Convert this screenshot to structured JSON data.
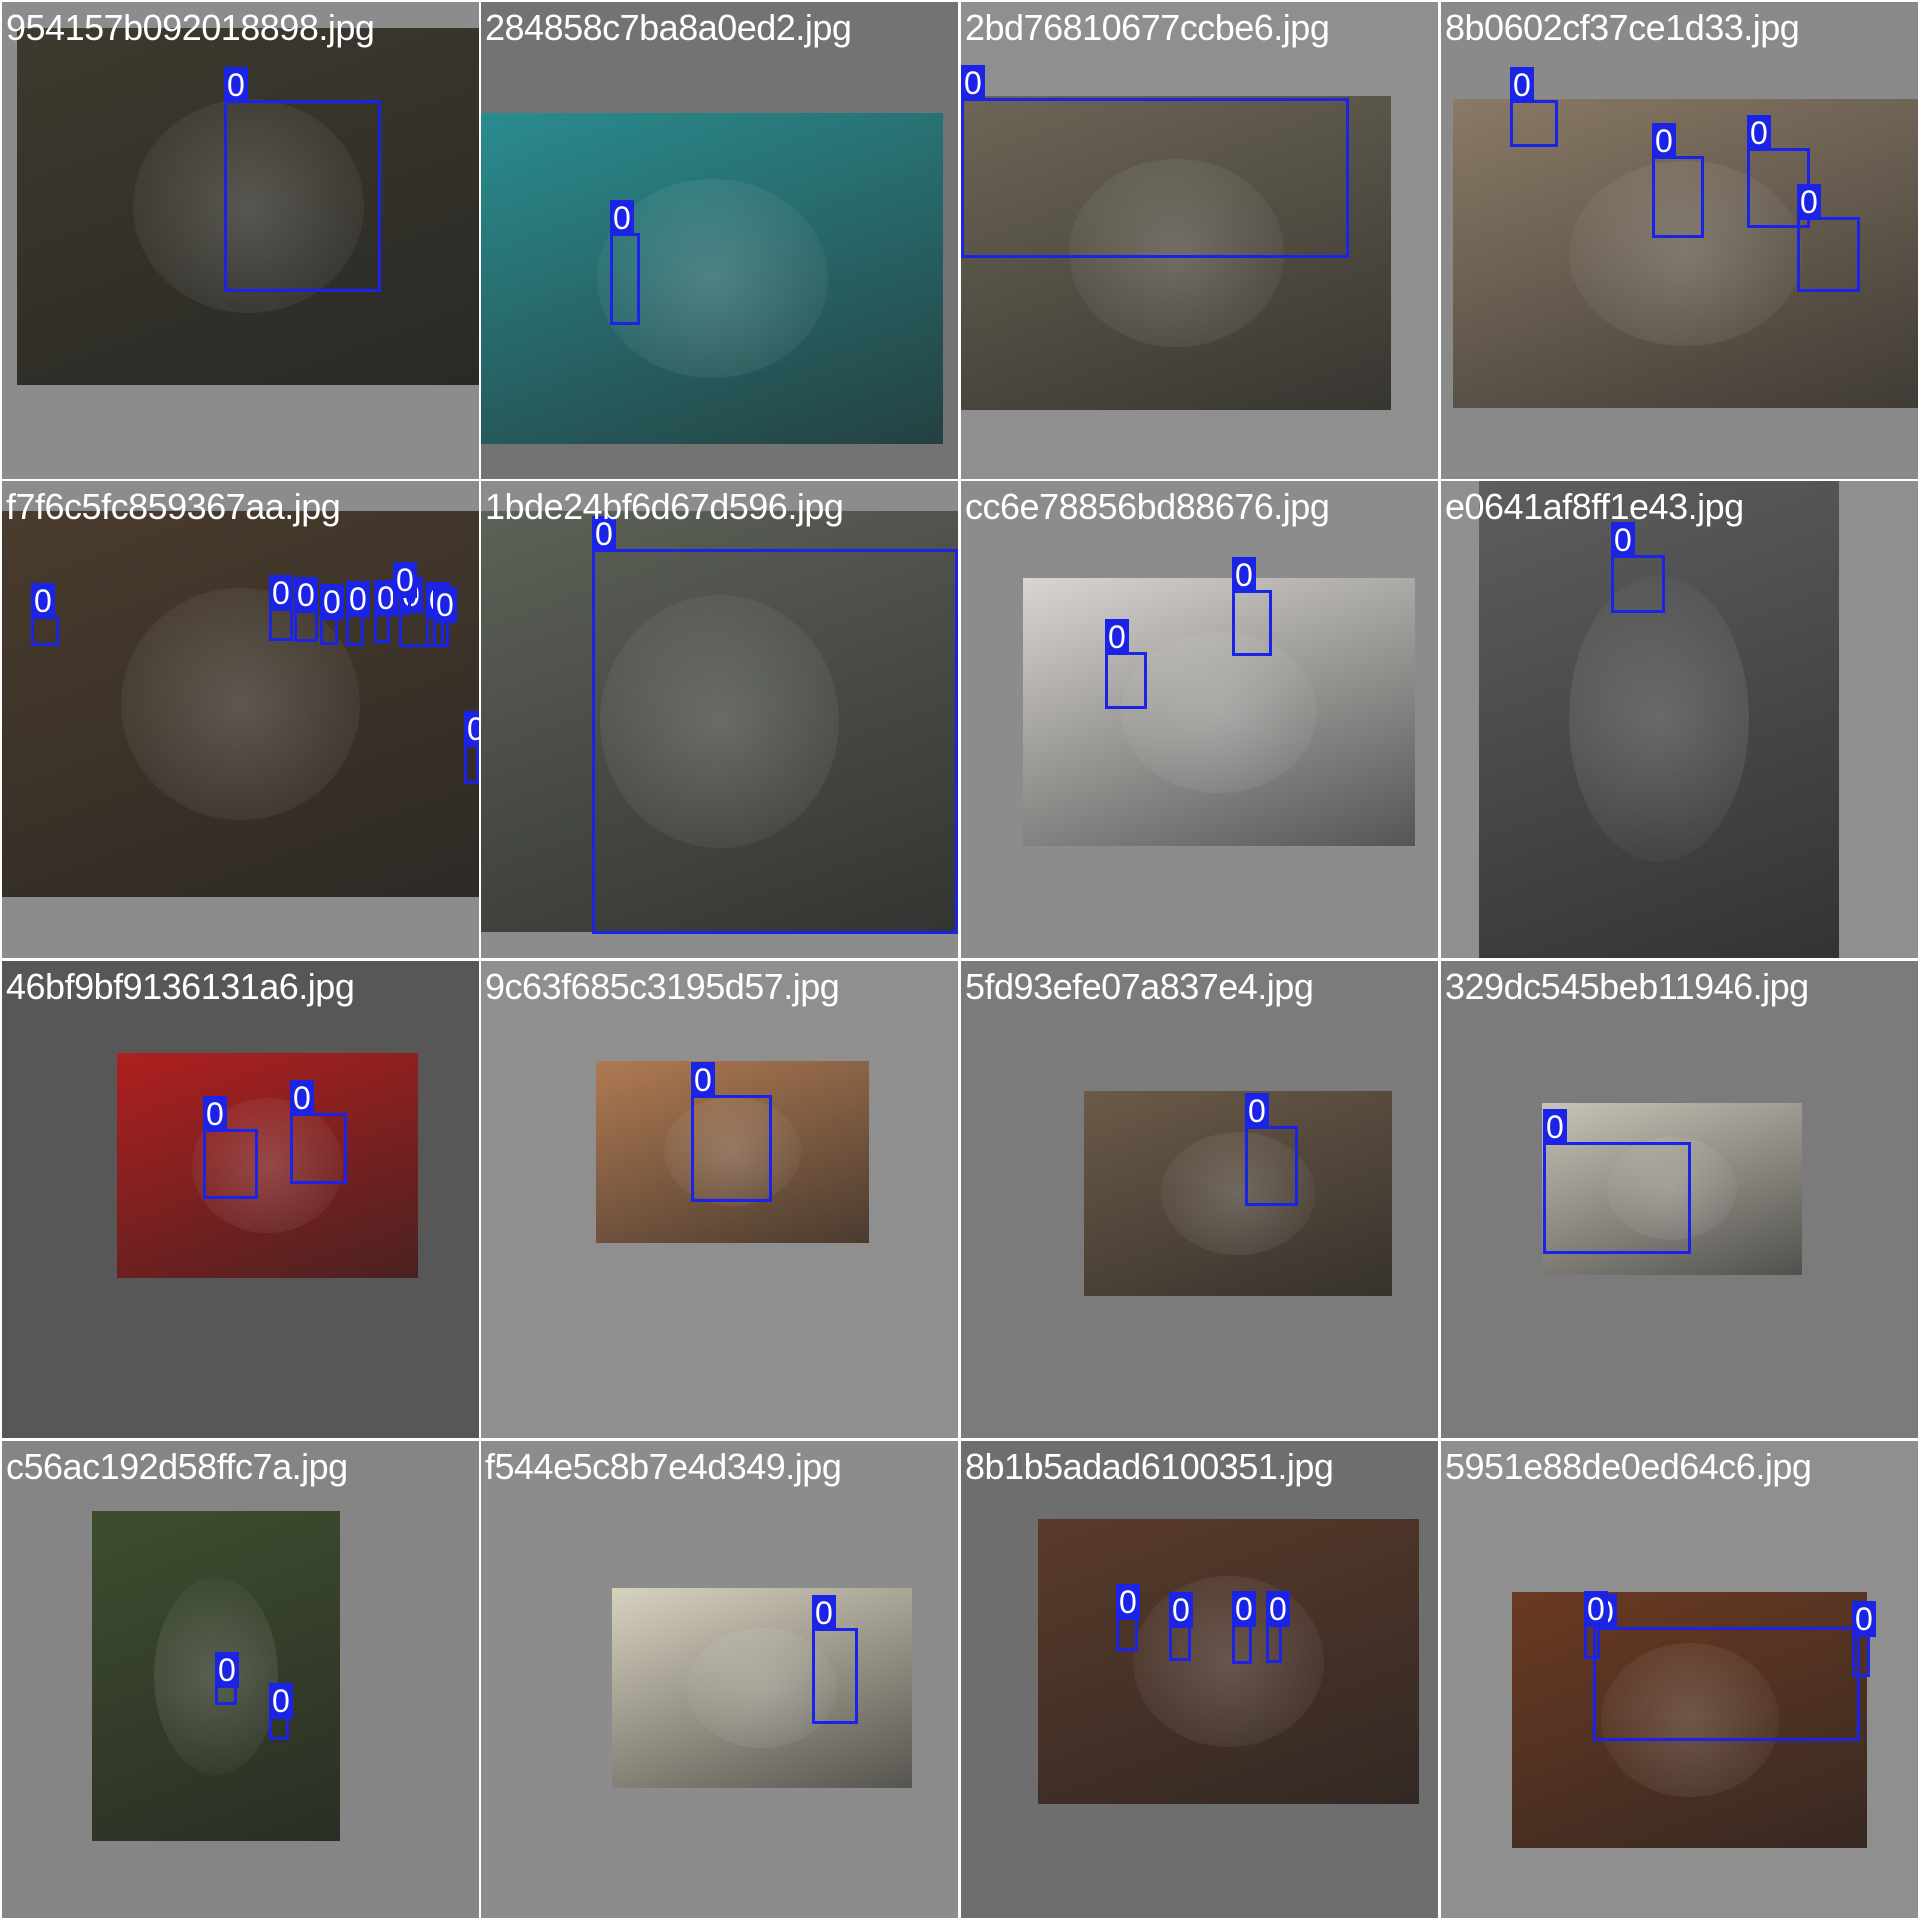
{
  "grid": {
    "tiles": [
      {
        "filename": "954157b092018898.jpg",
        "bg": "#8c8c8c",
        "photo_color": "#3d3a2e",
        "boxes": [
          {
            "class_label": "0"
          }
        ]
      },
      {
        "filename": "284858c7ba8a0ed2.jpg",
        "bg": "#737373",
        "photo_color": "#2a8c8f",
        "boxes": [
          {
            "class_label": "0"
          }
        ]
      },
      {
        "filename": "2bd76810677ccbe6.jpg",
        "bg": "#8f8f8f",
        "photo_color": "#6d6656",
        "boxes": [
          {
            "class_label": "0"
          }
        ]
      },
      {
        "filename": "8b0602cf37ce1d33.jpg",
        "bg": "#8a8a8a",
        "photo_color": "#8a7a66",
        "boxes": [
          {
            "class_label": "0"
          },
          {
            "class_label": "0"
          },
          {
            "class_label": "0"
          },
          {
            "class_label": "0"
          }
        ]
      },
      {
        "filename": "f7f6c5fc859367aa.jpg",
        "bg": "#8c8c8c",
        "photo_color": "#4a3c2d",
        "boxes": [
          {
            "class_label": "0"
          },
          {
            "class_label": "0"
          },
          {
            "class_label": "0"
          },
          {
            "class_label": "0"
          },
          {
            "class_label": "0"
          },
          {
            "class_label": "0"
          },
          {
            "class_label": "0"
          },
          {
            "class_label": "0"
          },
          {
            "class_label": "0"
          },
          {
            "class_label": "0"
          },
          {
            "class_label": "0"
          }
        ]
      },
      {
        "filename": "1bde24bf6d67d596.jpg",
        "bg": "#8c8c8c",
        "photo_color": "#5d6258",
        "boxes": [
          {
            "class_label": "0"
          }
        ]
      },
      {
        "filename": "cc6e78856bd88676.jpg",
        "bg": "#8c8c8c",
        "photo_color": "#d9d6d2",
        "boxes": [
          {
            "class_label": "0"
          },
          {
            "class_label": "0"
          }
        ]
      },
      {
        "filename": "e0641af8ff1e43.jpg",
        "bg": "#8f8f8f",
        "photo_color": "#5e5e5e",
        "boxes": [
          {
            "class_label": "0"
          }
        ]
      },
      {
        "filename": "46bf9bf9136131a6.jpg",
        "bg": "#575757",
        "photo_color": "#b01f1f",
        "boxes": [
          {
            "class_label": "0"
          },
          {
            "class_label": "0"
          }
        ]
      },
      {
        "filename": "9c63f685c3195d57.jpg",
        "bg": "#8f8f8f",
        "photo_color": "#b07a52",
        "boxes": [
          {
            "class_label": "0"
          }
        ]
      },
      {
        "filename": "5fd93efe07a837e4.jpg",
        "bg": "#7b7b7b",
        "photo_color": "#6b5a48",
        "boxes": [
          {
            "class_label": "0"
          }
        ]
      },
      {
        "filename": "329dc545beb11946.jpg",
        "bg": "#7b7b7b",
        "photo_color": "#c9c4b8",
        "boxes": [
          {
            "class_label": "0"
          }
        ]
      },
      {
        "filename": "c56ac192d58ffc7a.jpg",
        "bg": "#858585",
        "photo_color": "#3e4d2e",
        "boxes": [
          {
            "class_label": "0"
          },
          {
            "class_label": "0"
          }
        ]
      },
      {
        "filename": "f544e5c8b7e4d349.jpg",
        "bg": "#8c8c8c",
        "photo_color": "#d8d2bf",
        "boxes": [
          {
            "class_label": "0"
          }
        ]
      },
      {
        "filename": "8b1b5adad6100351.jpg",
        "bg": "#6e6e6e",
        "photo_color": "#5a3a2a",
        "boxes": [
          {
            "class_label": "0"
          },
          {
            "class_label": "0"
          },
          {
            "class_label": "0"
          },
          {
            "class_label": "0"
          }
        ]
      },
      {
        "filename": "5951e88de0ed64c6.jpg",
        "bg": "#8f8f8f",
        "photo_color": "#6b3a22",
        "boxes": [
          {
            "class_label": "0"
          },
          {
            "class_label": "0"
          },
          {
            "class_label": "0"
          }
        ]
      }
    ]
  }
}
